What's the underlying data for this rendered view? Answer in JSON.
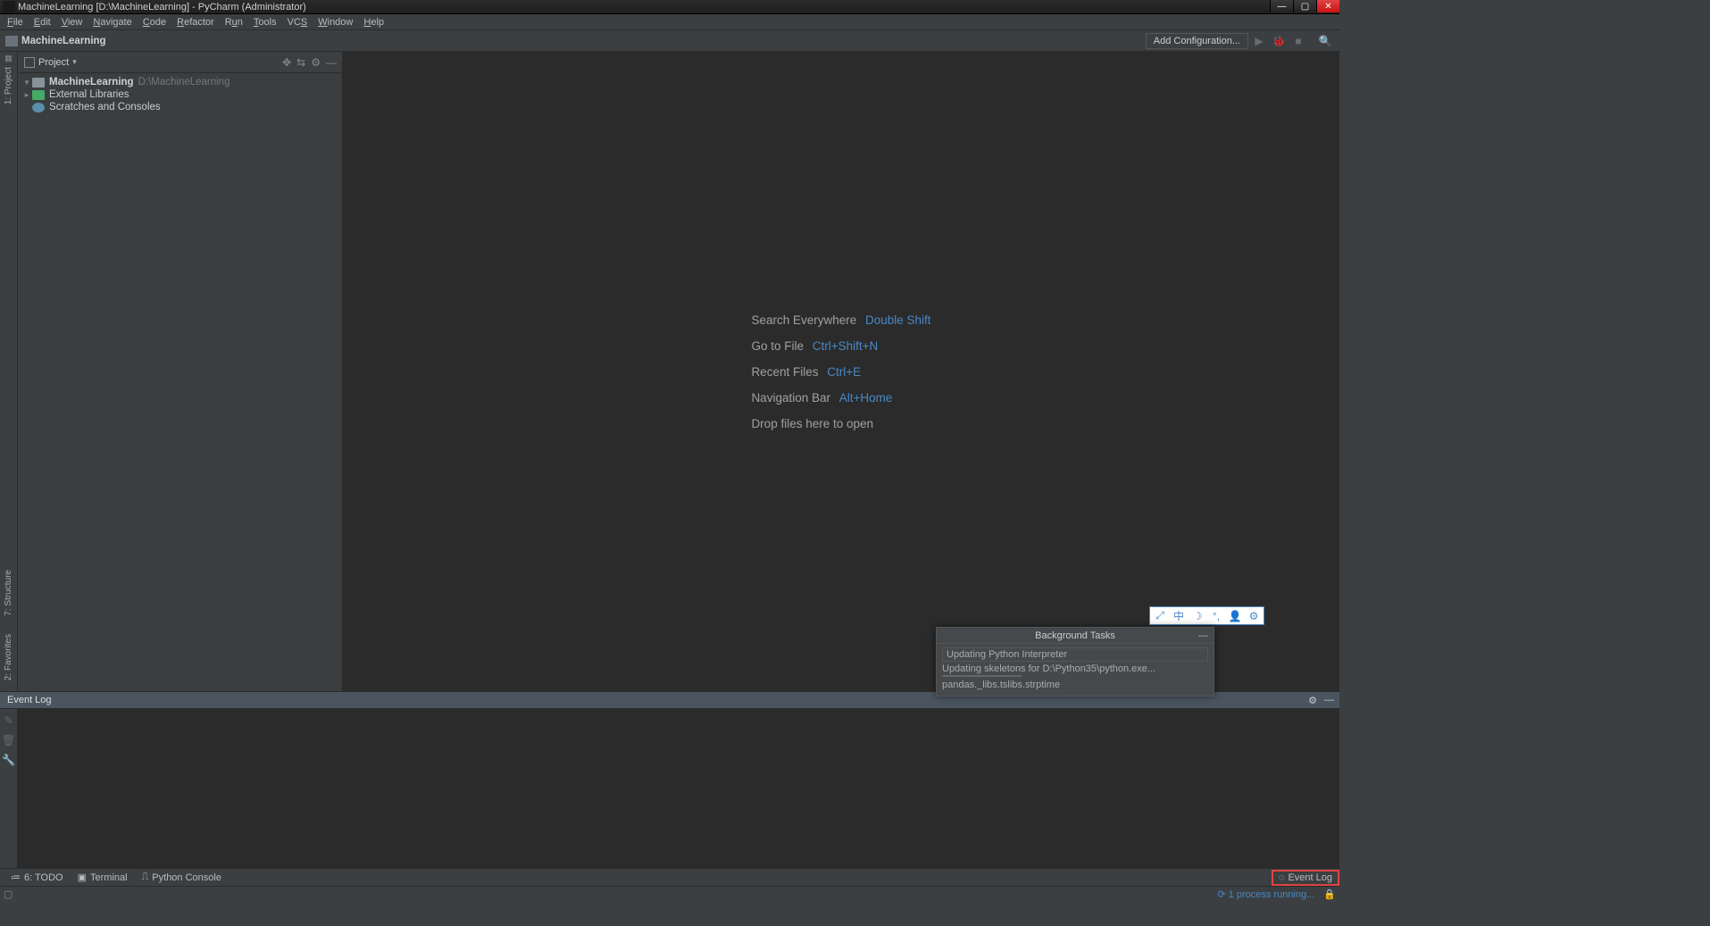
{
  "titlebar": {
    "text": "MachineLearning [D:\\MachineLearning] - PyCharm (Administrator)"
  },
  "menubar": [
    "File",
    "Edit",
    "View",
    "Navigate",
    "Code",
    "Refactor",
    "Run",
    "Tools",
    "VCS",
    "Window",
    "Help"
  ],
  "breadcrumb": {
    "project": "MachineLearning"
  },
  "run_config": {
    "add_cfg": "Add Configuration..."
  },
  "project_panel": {
    "title": "Project",
    "items": [
      {
        "name": "MachineLearning",
        "path": "D:\\MachineLearning",
        "icon": "folder",
        "bold": true,
        "indent": 1,
        "expand": "▾"
      },
      {
        "name": "External Libraries",
        "icon": "lib",
        "indent": 1,
        "expand": "▸"
      },
      {
        "name": "Scratches and Consoles",
        "icon": "scratch",
        "indent": 1,
        "expand": ""
      }
    ]
  },
  "gutter_left": {
    "project_tab": "1: Project",
    "structure_tab": "7: Structure",
    "favorites_tab": "2: Favorites"
  },
  "editor_hints": [
    {
      "label": "Search Everywhere",
      "shortcut": "Double Shift"
    },
    {
      "label": "Go to File",
      "shortcut": "Ctrl+Shift+N"
    },
    {
      "label": "Recent Files",
      "shortcut": "Ctrl+E"
    },
    {
      "label": "Navigation Bar",
      "shortcut": "Alt+Home"
    },
    {
      "label": "Drop files here to open",
      "shortcut": ""
    }
  ],
  "event_log": {
    "title": "Event Log"
  },
  "tool_windows": {
    "todo": "6: TODO",
    "terminal": "Terminal",
    "python_console": "Python Console",
    "event_log": "Event Log"
  },
  "status_bar": {
    "process": "1 process running..."
  },
  "background_tasks": {
    "title": "Background Tasks",
    "rows": [
      "Updating Python Interpreter",
      "Updating skeletons for D:\\Python35\\python.exe...",
      "pandas._libs.tslibs.strptime"
    ]
  }
}
